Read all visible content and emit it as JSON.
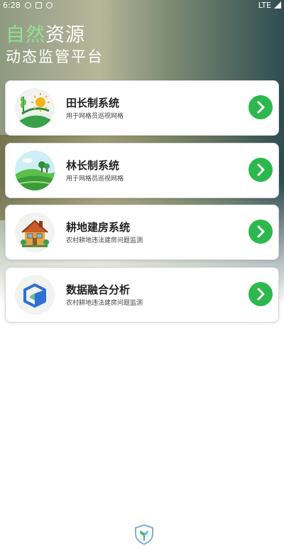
{
  "status_bar": {
    "time": "6:28",
    "network": "LTE"
  },
  "header": {
    "title_highlight": "自然",
    "title_rest": "资源",
    "subtitle": "动态监管平台"
  },
  "cards": [
    {
      "title": "田长制系统",
      "subtitle": "用于网格员巡视网格"
    },
    {
      "title": "林长制系统",
      "subtitle": "用于网格员巡视网格"
    },
    {
      "title": "耕地建房系统",
      "subtitle": "农村耕地违法建房问题监测"
    },
    {
      "title": "数据融合分析",
      "subtitle": "农村耕地违法建房问题监测"
    }
  ],
  "colors": {
    "accent_green": "#2db84d",
    "title_highlight": "#8fe38f"
  }
}
